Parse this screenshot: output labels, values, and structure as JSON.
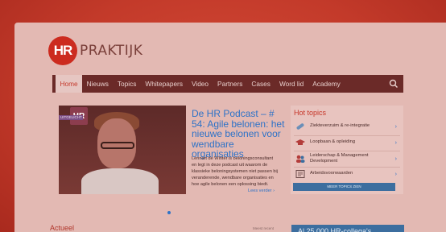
{
  "brand": {
    "logo_mark": "HR",
    "logo_text": "PRAKTIJK"
  },
  "nav": {
    "items": [
      "Home",
      "Nieuws",
      "Topics",
      "Whitepapers",
      "Video",
      "Partners",
      "Cases",
      "Word lid",
      "Academy"
    ],
    "active": "Home",
    "search_icon": "search-icon"
  },
  "hero": {
    "badge": "HR",
    "badge_label": "UITGELICHT",
    "title": "De HR Podcast – # 54: Agile belonen: het nieuwe belonen voor wendbare organisaties",
    "description": "Lennart de Winter is beloningsconsultant en legt in deze podcast uit waarom de klassieke beloningsystemen niet passen bij veranderende, wendbare organisaties en hoe agile belonen een oplossing biedt.",
    "more": "Lees verder ›"
  },
  "hot_topics": {
    "title": "Hot topics",
    "items": [
      {
        "label": "Ziekteverzuim & re-integratie",
        "icon": "bandage-icon"
      },
      {
        "label": "Loopbaan & opleiding",
        "icon": "graduation-cap-icon"
      },
      {
        "label": "Leiderschap & Management Development",
        "icon": "people-icon"
      },
      {
        "label": "Arbeidsvoorwaarden",
        "icon": "document-icon"
      }
    ],
    "more_button": "MEER TOPICS ZIEN"
  },
  "bottom": {
    "section_title": "Actueel",
    "sort_label": "Meest recent",
    "promo_text": "Al 25.000 HR-collega's"
  },
  "colors": {
    "accent": "#c63528",
    "link": "#2d72c7",
    "nav_bg": "#6b2a28",
    "button": "#3c6e9f"
  }
}
